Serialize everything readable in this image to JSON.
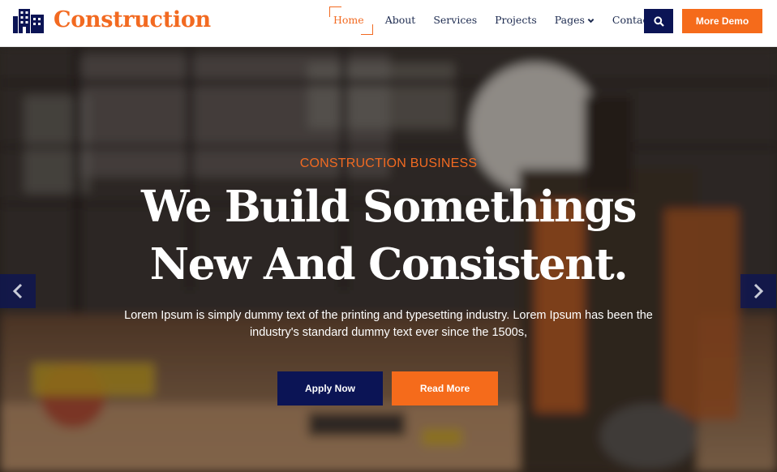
{
  "brand": {
    "name": "Construction",
    "icon": "building-icon",
    "color": "#f26a21"
  },
  "nav": {
    "items": [
      {
        "label": "Home",
        "active": true
      },
      {
        "label": "About",
        "active": false
      },
      {
        "label": "Services",
        "active": false
      },
      {
        "label": "Projects",
        "active": false
      },
      {
        "label": "Pages",
        "active": false,
        "dropdown": true
      },
      {
        "label": "Contact",
        "active": false
      }
    ],
    "search_icon": "search-icon",
    "cta_label": "More Demo"
  },
  "hero": {
    "eyebrow": "CONSTRUCTION BUSINESS",
    "headline_line1": "We Build Somethings",
    "headline_line2": "New And Consistent.",
    "lead_text": "Lorem Ipsum is simply dummy text of the printing and typesetting industry. Lorem Ipsum has been the industry's standard dummy text ever since the 1500s,",
    "primary_button": "Apply Now",
    "secondary_button": "Read More",
    "prev_icon": "chevron-left-icon",
    "next_icon": "chevron-right-icon"
  },
  "colors": {
    "accent": "#f26a21",
    "navy": "#0b1455",
    "button_orange": "#f56b1b",
    "nav_text": "#1c2a4f"
  }
}
